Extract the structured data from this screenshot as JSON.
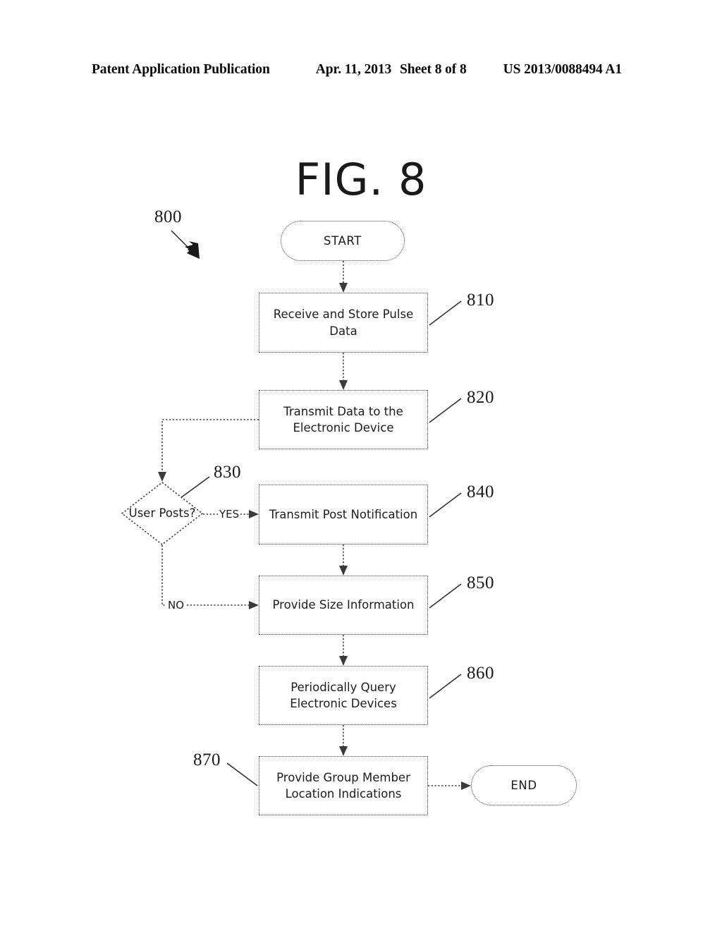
{
  "header": {
    "publication": "Patent Application Publication",
    "date": "Apr. 11, 2013",
    "sheet": "Sheet 8 of 8",
    "pub_number": "US 2013/0088494 A1"
  },
  "figure": {
    "title": "FIG. 8",
    "diagram_ref": "800"
  },
  "nodes": {
    "start": {
      "label": "START",
      "shape": "terminator"
    },
    "step_810": {
      "label": "Receive and Store Pulse Data",
      "ref": "810",
      "shape": "process"
    },
    "step_820": {
      "label": "Transmit Data to the Electronic Device",
      "ref": "820",
      "shape": "process"
    },
    "decision_830": {
      "label": "User Posts?",
      "ref": "830",
      "shape": "decision"
    },
    "step_840": {
      "label": "Transmit Post Notification",
      "ref": "840",
      "shape": "process"
    },
    "step_850": {
      "label": "Provide Size Information",
      "ref": "850",
      "shape": "process"
    },
    "step_860": {
      "label": "Periodically Query Electronic Devices",
      "ref": "860",
      "shape": "process"
    },
    "step_870": {
      "label": "Provide Group Member Location Indications",
      "ref": "870",
      "shape": "process"
    },
    "end": {
      "label": "END",
      "shape": "terminator"
    }
  },
  "edges": {
    "yes_label": "YES",
    "no_label": "NO"
  },
  "colors": {
    "ink": "#1a1a1a",
    "line": "#3a3a3a",
    "background": "#ffffff"
  },
  "chart_data": {
    "type": "diagram",
    "diagram_type": "flowchart",
    "title": "FIG. 8",
    "reference": "800",
    "nodes": [
      {
        "id": "start",
        "ref": null,
        "shape": "terminator",
        "text": "START"
      },
      {
        "id": "810",
        "ref": "810",
        "shape": "process",
        "text": "Receive and Store Pulse Data"
      },
      {
        "id": "820",
        "ref": "820",
        "shape": "process",
        "text": "Transmit Data to the Electronic Device"
      },
      {
        "id": "830",
        "ref": "830",
        "shape": "decision",
        "text": "User Posts?"
      },
      {
        "id": "840",
        "ref": "840",
        "shape": "process",
        "text": "Transmit Post Notification"
      },
      {
        "id": "850",
        "ref": "850",
        "shape": "process",
        "text": "Provide Size Information"
      },
      {
        "id": "860",
        "ref": "860",
        "shape": "process",
        "text": "Periodically Query Electronic Devices"
      },
      {
        "id": "870",
        "ref": "870",
        "shape": "process",
        "text": "Provide Group Member Location Indications"
      },
      {
        "id": "end",
        "ref": null,
        "shape": "terminator",
        "text": "END"
      }
    ],
    "links": [
      {
        "from": "start",
        "to": "810",
        "label": ""
      },
      {
        "from": "810",
        "to": "820",
        "label": ""
      },
      {
        "from": "820",
        "to": "830",
        "label": ""
      },
      {
        "from": "830",
        "to": "840",
        "label": "YES"
      },
      {
        "from": "830",
        "to": "850",
        "label": "NO"
      },
      {
        "from": "840",
        "to": "850",
        "label": ""
      },
      {
        "from": "850",
        "to": "860",
        "label": ""
      },
      {
        "from": "860",
        "to": "870",
        "label": ""
      },
      {
        "from": "870",
        "to": "end",
        "label": ""
      }
    ]
  }
}
